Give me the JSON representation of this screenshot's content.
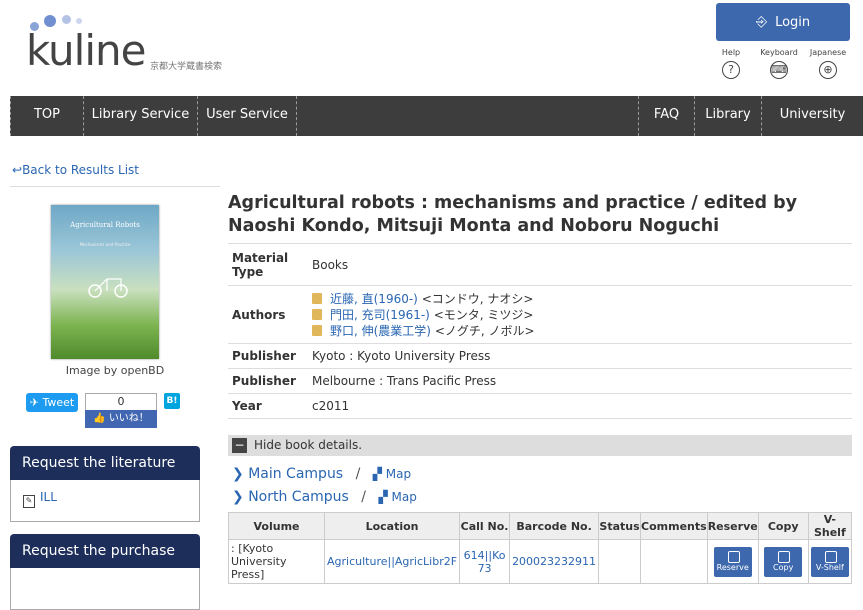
{
  "logo": {
    "text": "kuline",
    "subtitle": "京都大学蔵書検索"
  },
  "header": {
    "login_label": "Login",
    "icons": [
      {
        "label": "Help",
        "icon": "help-icon",
        "glyph": "?"
      },
      {
        "label": "Keyboard",
        "icon": "keyboard-icon",
        "glyph": "⌨"
      },
      {
        "label": "Japanese",
        "icon": "globe-icon",
        "glyph": "⊕"
      }
    ]
  },
  "nav": {
    "left": [
      "TOP",
      "Library Service",
      "User Service"
    ],
    "right": [
      "FAQ",
      "Library",
      "University"
    ]
  },
  "back_label": "Back to Results List",
  "cover": {
    "title": "Agricultural Robots",
    "subtitle": "Mechanisms and Practice",
    "caption": "Image by openBD"
  },
  "social": {
    "tweet": "Tweet",
    "fb_count": "0",
    "fb_like": "いいね！",
    "hatena": "B!"
  },
  "side_boxes": [
    {
      "title": "Request the literature",
      "item": "ILL"
    },
    {
      "title": "Request the purchase",
      "item": ""
    }
  ],
  "book": {
    "title": "Agricultural robots : mechanisms and practice / edited by Naoshi Kondo, Mitsuji Monta and Noboru Noguchi",
    "material_type_key": "Material Type",
    "material_type": "Books",
    "authors_key": "Authors",
    "authors": [
      {
        "name": "近藤, 直(1960-)",
        "kana": "<コンドウ, ナオシ>"
      },
      {
        "name": "門田, 充司(1961-)",
        "kana": "<モンタ, ミツジ>"
      },
      {
        "name": "野口, 伸(農業工学)",
        "kana": "<ノグチ, ノボル>"
      }
    ],
    "publishers": [
      {
        "key": "Publisher",
        "value": "Kyoto : Kyoto University Press"
      },
      {
        "key": "Publisher",
        "value": "Melbourne : Trans Pacific Press"
      }
    ],
    "year_key": "Year",
    "year": "c2011"
  },
  "hide_details": "Hide book details.",
  "campuses": [
    {
      "name": "Main Campus",
      "map": "Map",
      "chevron": "›"
    },
    {
      "name": "North Campus",
      "map": "Map",
      "chevron": "⌄"
    }
  ],
  "holdings": {
    "headers": [
      "Volume",
      "Location",
      "Call No.",
      "Barcode No.",
      "Status",
      "Comments",
      "Reserve",
      "Copy",
      "V-Shelf"
    ],
    "rows": [
      {
        "volume": ": [Kyoto University Press]",
        "location": "Agriculture||AgricLibr2F",
        "call_no": "614||Ko 73",
        "barcode": "200023232911",
        "status": "",
        "comments": "",
        "reserve": "Reserve",
        "copy": "Copy",
        "vshelf": "V-Shelf"
      }
    ]
  },
  "colors": {
    "brand": "#3d68ad",
    "nav": "#3d3d3d",
    "box": "#1d2e5a",
    "link": "#2a66b2"
  }
}
